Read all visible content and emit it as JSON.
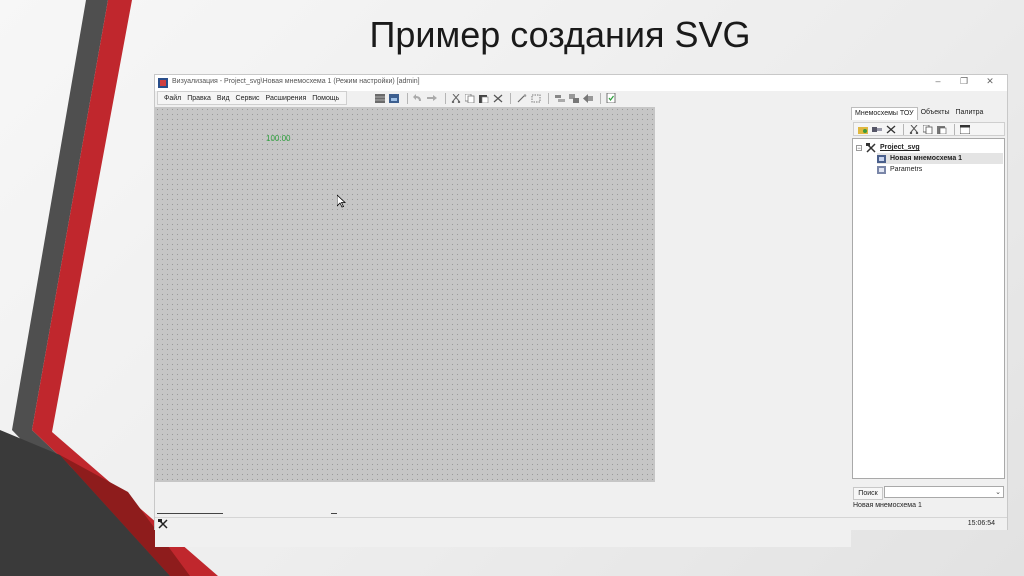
{
  "slide": {
    "title": "Пример создания SVG"
  },
  "window": {
    "title": "Визуализация - Project_svg\\Новая мнемосхема 1 (Режим настройки) [admin]",
    "controls": {
      "minimize": "–",
      "maximize": "❐",
      "close": "✕"
    }
  },
  "menu": {
    "items": [
      {
        "label": "Файл"
      },
      {
        "label": "Правка"
      },
      {
        "label": "Вид"
      },
      {
        "label": "Сервис"
      },
      {
        "label": "Расширения"
      },
      {
        "label": "Помощь"
      }
    ]
  },
  "canvas": {
    "clock_text": "100:00"
  },
  "panel": {
    "tabs": [
      {
        "label": "Мнемосхемы ТОУ"
      },
      {
        "label": "Объекты"
      },
      {
        "label": "Палитра"
      }
    ],
    "tree": {
      "project": "Project_svg",
      "items": [
        {
          "label": "Новая мнемосхема 1"
        },
        {
          "label": "Parametrs"
        }
      ]
    },
    "search": {
      "label": "Поиск",
      "value": ""
    },
    "selected": "Новая мнемосхема 1"
  },
  "status": {
    "clock": "15:06:54"
  },
  "colors": {
    "accent_red": "#c0272d",
    "dark_gray": "#4a4a4a",
    "clock_green": "#2c9e3b"
  }
}
